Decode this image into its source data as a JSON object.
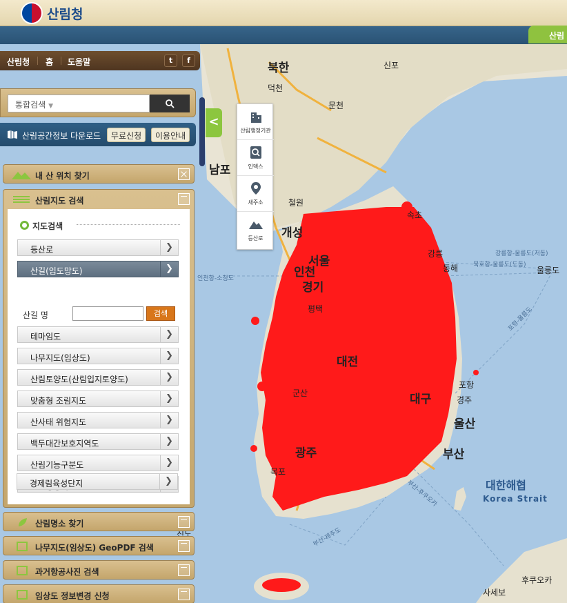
{
  "header": {
    "title": "산림청",
    "corner_tab": "산림"
  },
  "topnav": {
    "items": [
      "산림청",
      "홈",
      "도움말"
    ],
    "twitter": "t",
    "facebook": "f"
  },
  "search": {
    "placeholder": "통합검색"
  },
  "download": {
    "label": "산림공간정보 다운로드",
    "free_apply": "무료신청",
    "guide": "이용안내"
  },
  "sections": {
    "my_location": "내 산 위치 찾기",
    "forest_map": "산림지도 검색",
    "famous_places": "산림명소 찾기",
    "tree_map_geopdf": "나무지도(임상도) GeoPDF 검색",
    "aerial_photos": "과거항공사진 검색",
    "forest_change": "임상도 정보변경 신청"
  },
  "map_search": {
    "subtitle": "지도검색",
    "items": [
      {
        "label": "등산로",
        "active": false
      },
      {
        "label": "산길(임도망도)",
        "active": true
      },
      {
        "label": "테마임도",
        "active": false
      },
      {
        "label": "나무지도(임상도)",
        "active": false
      },
      {
        "label": "산림토양도(산림입지토양도)",
        "active": false
      },
      {
        "label": "맞춤형 조림지도",
        "active": false
      },
      {
        "label": "산사태 위험지도",
        "active": false
      },
      {
        "label": "백두대간보호지역도",
        "active": false
      },
      {
        "label": "산림기능구분도",
        "active": false
      },
      {
        "label": "산림행정기관",
        "active": false
      },
      {
        "label": "경제림육성단지",
        "active": false
      }
    ],
    "road_name_label": "산길 명",
    "road_name_button": "검색"
  },
  "map_tools": {
    "collapse": "<",
    "items": [
      {
        "label": "산림행정기관",
        "icon": "building-icon"
      },
      {
        "label": "인덱스",
        "icon": "index-search-icon"
      },
      {
        "label": "새주소",
        "icon": "location-pin-icon"
      },
      {
        "label": "등산로",
        "icon": "mountain-icon"
      }
    ]
  },
  "map": {
    "cities": [
      "북한",
      "신포",
      "덕천",
      "문천",
      "남포",
      "철원",
      "속초",
      "개성",
      "서울",
      "인천",
      "경기",
      "강릉",
      "동해",
      "평택",
      "대전",
      "포항",
      "경주",
      "군산",
      "대구",
      "울산",
      "부산",
      "광주",
      "목포",
      "후쿠오카",
      "사세보",
      "울릉도",
      "진도",
      "대한해협"
    ],
    "sea_label_ko": "대한해협",
    "sea_label_en": "Korea Strait",
    "routes": [
      "강릉항-울릉도(저동)",
      "묵호항-울릉도(도동)",
      "인천항-소청도",
      "포항-울릉도",
      "부산-제주도",
      "부산-후쿠오카",
      "제주"
    ],
    "cities_top": {
      "bukhan": "북한",
      "sinpo": "신포",
      "deokcheon": "덕천",
      "muncheon": "문천",
      "nampo": "남포",
      "cheorwon": "철원",
      "sokcho": "속초",
      "gaeseong": "개성",
      "seoul": "서울",
      "incheon": "인천",
      "gyeonggi": "경기",
      "gangneung": "강릉",
      "donghae": "동해",
      "pyeongtaek": "평택",
      "daejeon": "대전",
      "pohang": "포항",
      "gyeongju": "경주",
      "gunsan": "군산",
      "daegu": "대구",
      "ulsan": "울산",
      "busan": "부산",
      "gwangju": "광주",
      "mokpo": "목포",
      "fukuoka": "후쿠오카",
      "sasebo": "사세보",
      "ulleungdo": "울릉도",
      "jindo": "진도"
    }
  }
}
